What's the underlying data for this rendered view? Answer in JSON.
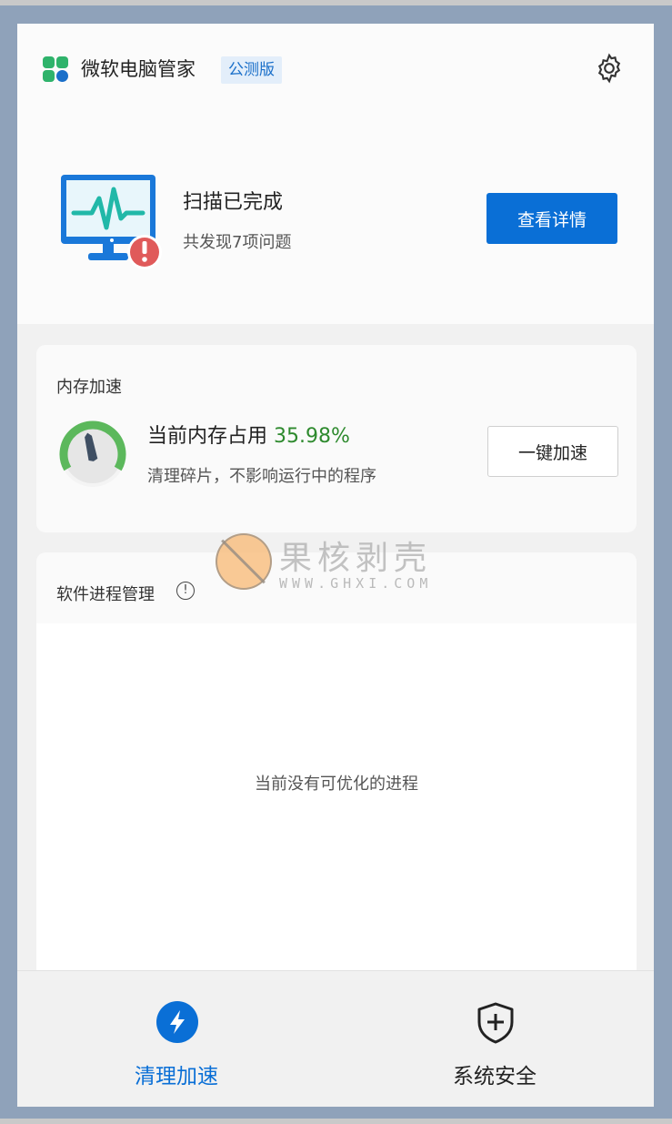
{
  "header": {
    "app_title": "微软电脑管家",
    "edition_badge": "公测版",
    "settings_icon": "gear-icon"
  },
  "scan": {
    "title": "扫描已完成",
    "subtitle": "共发现7项问题",
    "details_button": "查看详情",
    "status_icon": "monitor-alert-icon"
  },
  "memory": {
    "card_title": "内存加速",
    "usage_label": "当前内存占用",
    "usage_percent": "35.98%",
    "usage_value": 35.98,
    "subtitle": "清理碎片，不影响运行中的程序",
    "boost_button": "一键加速"
  },
  "process": {
    "card_title": "软件进程管理",
    "empty_message": "当前没有可优化的进程"
  },
  "watermark": {
    "text_cn": "果核剥壳",
    "text_en": "WWW.GHXI.COM"
  },
  "nav": {
    "items": [
      {
        "label": "清理加速",
        "icon": "lightning-icon",
        "active": true
      },
      {
        "label": "系统安全",
        "icon": "shield-plus-icon",
        "active": false
      }
    ]
  },
  "colors": {
    "accent": "#0a6fd6",
    "success": "#2e8a2e",
    "alert": "#e05a5a",
    "background": "#8fa2ba"
  }
}
